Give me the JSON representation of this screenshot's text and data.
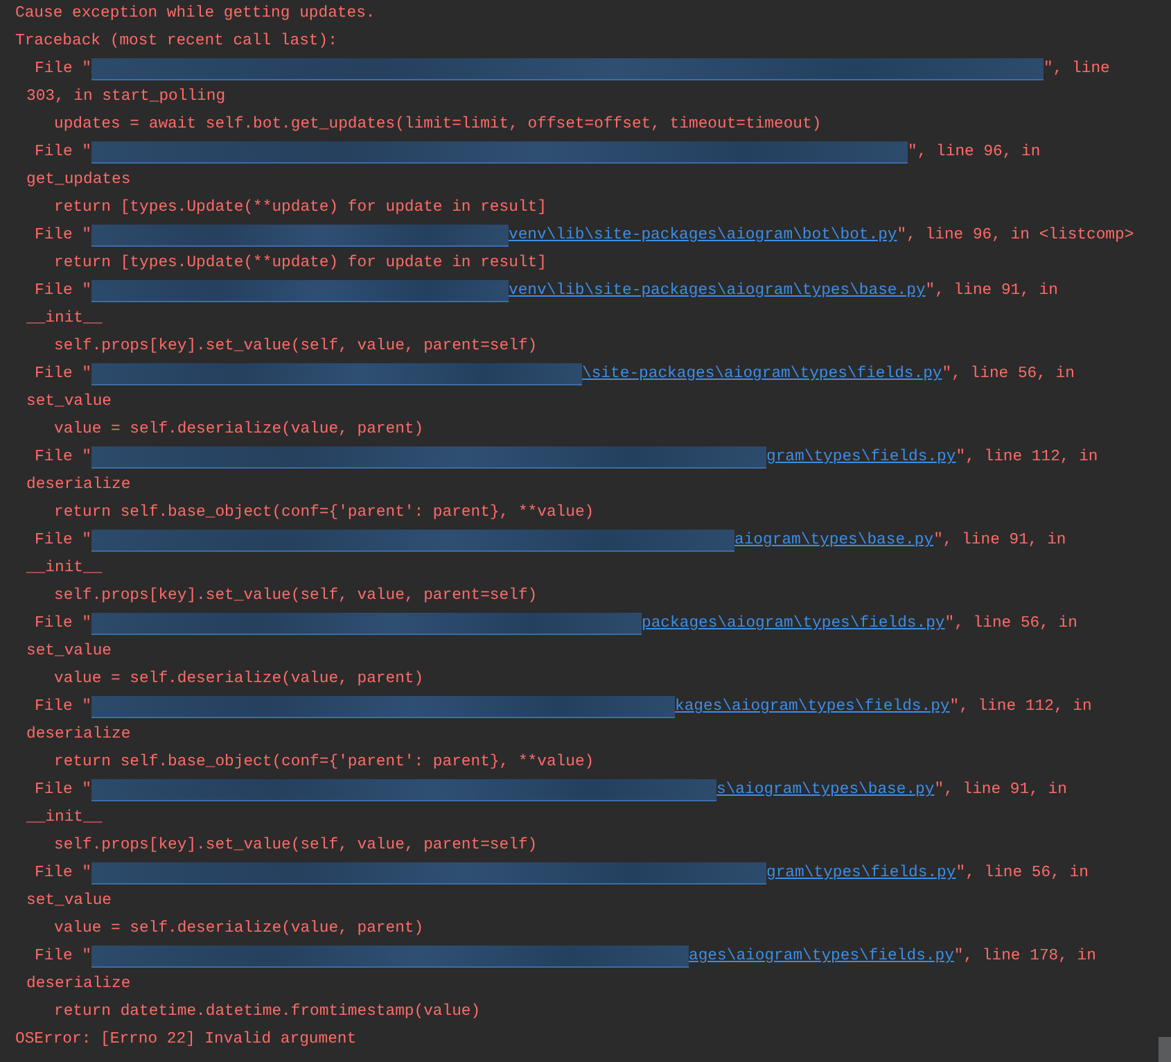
{
  "console": {
    "lines": [
      {
        "kind": "message",
        "text": "Cause exception while getting updates."
      },
      {
        "kind": "message",
        "text": "Traceback (most recent call last):"
      },
      {
        "kind": "file",
        "prefix": "File \"",
        "suffix": "\", line"
      },
      {
        "kind": "wrap",
        "text": "303, in start_polling"
      },
      {
        "kind": "code",
        "text": "updates = await self.bot.get_updates(limit=limit, offset=offset, timeout=timeout)"
      },
      {
        "kind": "file",
        "prefix": "File \"",
        "suffix": "\", line 96, in"
      },
      {
        "kind": "wrap",
        "text": "get_updates"
      },
      {
        "kind": "code",
        "text": "return [types.Update(**update) for update in result]"
      },
      {
        "kind": "file",
        "prefix": "File \"",
        "path": "venv\\lib\\site-packages\\aiogram\\bot\\bot.py",
        "suffix": "\", line 96, in <listcomp>"
      },
      {
        "kind": "code",
        "text": "return [types.Update(**update) for update in result]"
      },
      {
        "kind": "file",
        "prefix": "File \"",
        "path": "venv\\lib\\site-packages\\aiogram\\types\\base.py",
        "suffix": "\", line 91, in"
      },
      {
        "kind": "wrap",
        "text": "__init__"
      },
      {
        "kind": "code",
        "text": "self.props[key].set_value(self, value, parent=self)"
      },
      {
        "kind": "file",
        "prefix": "File \"",
        "path": "\\site-packages\\aiogram\\types\\fields.py",
        "suffix": "\", line 56, in"
      },
      {
        "kind": "wrap",
        "text": "set_value"
      },
      {
        "kind": "code",
        "text": "value = self.deserialize(value, parent)"
      },
      {
        "kind": "file",
        "prefix": "File \"",
        "path": "gram\\types\\fields.py",
        "suffix": "\", line 112, in"
      },
      {
        "kind": "wrap",
        "text": "deserialize"
      },
      {
        "kind": "code",
        "text": "return self.base_object(conf={'parent': parent}, **value)"
      },
      {
        "kind": "file",
        "prefix": "File \"",
        "path": "aiogram\\types\\base.py",
        "suffix": "\", line 91, in"
      },
      {
        "kind": "wrap",
        "text": "__init__"
      },
      {
        "kind": "code",
        "text": "self.props[key].set_value(self, value, parent=self)"
      },
      {
        "kind": "file",
        "prefix": "File \"",
        "path": "packages\\aiogram\\types\\fields.py",
        "suffix": "\", line 56, in"
      },
      {
        "kind": "wrap",
        "text": "set_value"
      },
      {
        "kind": "code",
        "text": "value = self.deserialize(value, parent)"
      },
      {
        "kind": "file",
        "prefix": "File \"",
        "path": "kages\\aiogram\\types\\fields.py",
        "suffix": "\", line 112, in"
      },
      {
        "kind": "wrap",
        "text": "deserialize"
      },
      {
        "kind": "code",
        "text": "return self.base_object(conf={'parent': parent}, **value)"
      },
      {
        "kind": "file",
        "prefix": "File \"",
        "path": "s\\aiogram\\types\\base.py",
        "suffix": "\", line 91, in"
      },
      {
        "kind": "wrap",
        "text": "__init__"
      },
      {
        "kind": "code",
        "text": "self.props[key].set_value(self, value, parent=self)"
      },
      {
        "kind": "file",
        "prefix": "File \"",
        "path": "gram\\types\\fields.py",
        "suffix": "\", line 56, in"
      },
      {
        "kind": "wrap",
        "text": "set_value"
      },
      {
        "kind": "code",
        "text": "value = self.deserialize(value, parent)"
      },
      {
        "kind": "file",
        "prefix": "File \"",
        "path": "ages\\aiogram\\types\\fields.py",
        "suffix": "\", line 178, in"
      },
      {
        "kind": "wrap",
        "text": "deserialize"
      },
      {
        "kind": "code",
        "text": "return datetime.datetime.fromtimestamp(value)"
      },
      {
        "kind": "message",
        "text": "OSError: [Errno 22] Invalid argument"
      }
    ]
  }
}
